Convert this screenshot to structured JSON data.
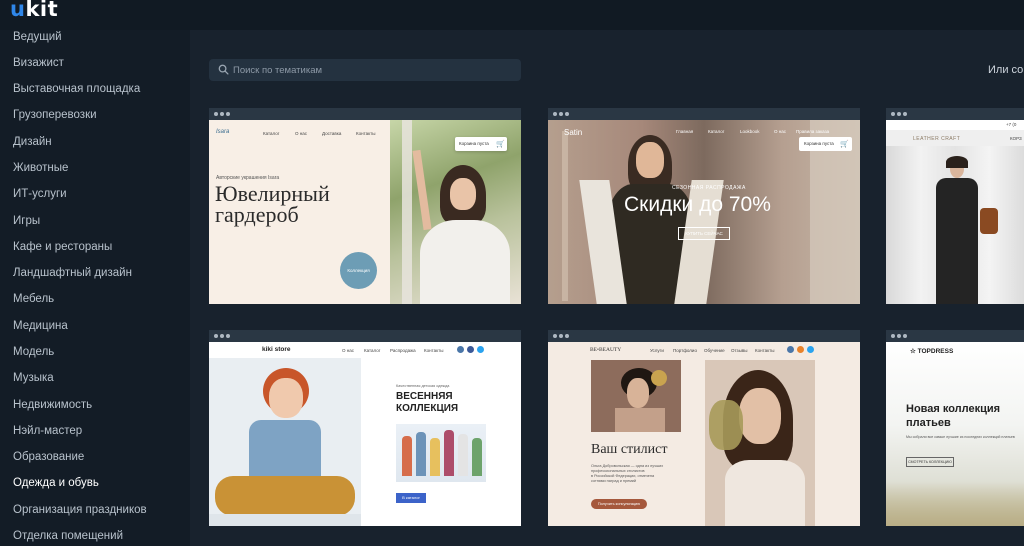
{
  "app": {
    "logo_u": "u",
    "logo_rest": "kit"
  },
  "sidebar": {
    "items": [
      {
        "label": "Ведущий"
      },
      {
        "label": "Визажист"
      },
      {
        "label": "Выставочная площадка"
      },
      {
        "label": "Грузоперевозки"
      },
      {
        "label": "Дизайн"
      },
      {
        "label": "Животные"
      },
      {
        "label": "ИТ-услуги"
      },
      {
        "label": "Игры"
      },
      {
        "label": "Кафе и рестораны"
      },
      {
        "label": "Ландшафтный дизайн"
      },
      {
        "label": "Мебель"
      },
      {
        "label": "Медицина"
      },
      {
        "label": "Модель"
      },
      {
        "label": "Музыка"
      },
      {
        "label": "Недвижимость"
      },
      {
        "label": "Нэйл-мастер"
      },
      {
        "label": "Образование"
      },
      {
        "label": "Одежда и обувь"
      },
      {
        "label": "Организация праздников"
      },
      {
        "label": "Отделка помещений"
      }
    ],
    "active_index": 17
  },
  "search": {
    "placeholder": "Поиск по тематикам"
  },
  "header": {
    "or_text": "Или со"
  },
  "templates": {
    "t1": {
      "brand": "Isara",
      "nav": [
        "Каталог",
        "О нас",
        "Доставка",
        "Контакты"
      ],
      "subtitle": "Авторские украшения Isara",
      "title_line1": "Ювелирный",
      "title_line2": "гардероб",
      "cta": "Коллекция",
      "cart": "Корзина пуста"
    },
    "t2": {
      "brand": "Satin",
      "nav": [
        "Главная",
        "Каталог",
        "Lookbook",
        "О нас",
        "Правила заказа"
      ],
      "cart": "Корзина пуста",
      "kicker": "СЕЗОННАЯ РАСПРОДАЖА",
      "title": "Скидки до 70%",
      "cta": "КУПИТЬ СЕЙЧАС"
    },
    "t3": {
      "brand": "LEATHER CRAFT",
      "top_right": "КОРЗ",
      "top_left": "+7 (0"
    },
    "t4": {
      "brand": "kiki store",
      "nav": [
        "О нас",
        "Каталог",
        "Распродажа",
        "Контакты"
      ],
      "subtitle": "Качественная детская одежда",
      "title_line1": "ВЕСЕННЯЯ",
      "title_line2": "КОЛЛЕКЦИЯ",
      "cta": "В каталог"
    },
    "t5": {
      "brand": "BE•BEAUTY",
      "nav": [
        "Услуги",
        "Портфолио",
        "Обучение",
        "Отзывы",
        "Контакты"
      ],
      "title": "Ваш стилист",
      "desc_line1": "Ольга Добровольская — одна из лучших",
      "desc_line2": "профессиональных стилистов",
      "desc_line3": "в Российской Федерации, отмечена",
      "desc_line4": "сотнями наград и премий",
      "cta": "Получить консультацию"
    },
    "t6": {
      "brand": "TOPDRESS",
      "title_line1": "Новая коллекция",
      "title_line2": "платьев",
      "desc": "Мы собрали все самые лучшие из последних коллекций платьев",
      "cta": "СМОТРЕТЬ КОЛЛЕКЦИЮ"
    }
  },
  "colors": {
    "background": "#18222d",
    "sidebar": "#131c26",
    "topbar": "#111a23",
    "logo_accent": "#2f86e8",
    "card_chrome": "#2a3744"
  }
}
